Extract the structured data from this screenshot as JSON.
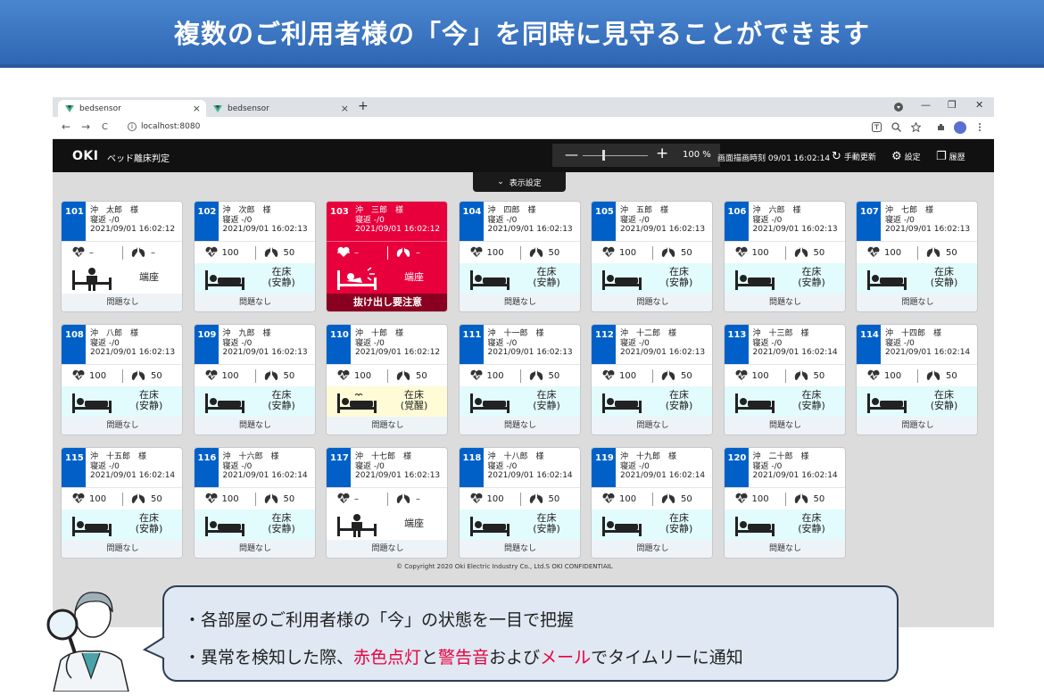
{
  "slide": {
    "title": "複数のご利用者様の「今」を同時に見守ることができます",
    "callout": {
      "line1": "・各部屋のご利用者様の「今」の状態を一目で把握",
      "line2_parts": [
        "・異常を検知した際、",
        "赤色点灯",
        "と",
        "警告音",
        "および",
        "メール",
        "でタイムリーに通知"
      ]
    }
  },
  "browser": {
    "tabs": [
      {
        "label": "bedsensor",
        "close": "×"
      },
      {
        "label": "bedsensor",
        "close": "×"
      }
    ],
    "new_tab": "+",
    "window_controls": {
      "minimize": "—",
      "restore": "❐",
      "close": "✕"
    },
    "nav": {
      "back": "←",
      "forward": "→",
      "reload": "C"
    },
    "url": "localhost:8080",
    "info_icon": "i"
  },
  "app": {
    "logo": "OKI",
    "title": "ベッド離床判定",
    "zoom": {
      "minus": "—",
      "plus": "+",
      "value": "100 %",
      "level": 0.3
    },
    "refresh_time": "画面描画時刻 09/01 16:02:14",
    "manual_refresh": "手動更新",
    "settings": "設定",
    "history": "履歴",
    "display_settings": "表示設定",
    "copyright": "© Copyright 2020 Oki Electric Industry Co., Ltd.S OKI CONFIDENTIAIL",
    "rooms": [
      {
        "room": "101",
        "name": "沖　太郎　様",
        "turn": "寝返 -/0",
        "time": "2021/09/01 16:02:12",
        "heart": "–",
        "breath": "–",
        "state": "sit",
        "status_text": "端座",
        "foot": "問題なし"
      },
      {
        "room": "102",
        "name": "沖　次郎　様",
        "turn": "寝返 -/0",
        "time": "2021/09/01 16:02:13",
        "heart": "100",
        "breath": "50",
        "state": "rest",
        "status_line1": "在床",
        "status_line2": "(安静)",
        "foot": "問題なし"
      },
      {
        "room": "103",
        "name": "沖　三郎　様",
        "turn": "寝返 -/0",
        "time": "2021/09/01 16:02:12",
        "heart": "–",
        "breath": "–",
        "state": "alert",
        "status_text": "端座",
        "foot": "抜け出し要注意"
      },
      {
        "room": "104",
        "name": "沖　四郎　様",
        "turn": "寝返 -/0",
        "time": "2021/09/01 16:02:13",
        "heart": "100",
        "breath": "50",
        "state": "rest",
        "status_line1": "在床",
        "status_line2": "(安静)",
        "foot": "問題なし"
      },
      {
        "room": "105",
        "name": "沖　五郎　様",
        "turn": "寝返 -/0",
        "time": "2021/09/01 16:02:13",
        "heart": "100",
        "breath": "50",
        "state": "rest",
        "status_line1": "在床",
        "status_line2": "(安静)",
        "foot": "問題なし"
      },
      {
        "room": "106",
        "name": "沖　六郎　様",
        "turn": "寝返 -/0",
        "time": "2021/09/01 16:02:13",
        "heart": "100",
        "breath": "50",
        "state": "rest",
        "status_line1": "在床",
        "status_line2": "(安静)",
        "foot": "問題なし"
      },
      {
        "room": "107",
        "name": "沖　七郎　様",
        "turn": "寝返 -/0",
        "time": "2021/09/01 16:02:13",
        "heart": "100",
        "breath": "50",
        "state": "rest",
        "status_line1": "在床",
        "status_line2": "(安静)",
        "foot": "問題なし"
      },
      {
        "room": "108",
        "name": "沖　八郎　様",
        "turn": "寝返 -/0",
        "time": "2021/09/01 16:02:13",
        "heart": "100",
        "breath": "50",
        "state": "rest",
        "status_line1": "在床",
        "status_line2": "(安静)",
        "foot": "問題なし"
      },
      {
        "room": "109",
        "name": "沖　九郎　様",
        "turn": "寝返 -/0",
        "time": "2021/09/01 16:02:13",
        "heart": "100",
        "breath": "50",
        "state": "rest",
        "status_line1": "在床",
        "status_line2": "(安静)",
        "foot": "問題なし"
      },
      {
        "room": "110",
        "name": "沖　十郎　様",
        "turn": "寝返 -/0",
        "time": "2021/09/01 16:02:12",
        "heart": "100",
        "breath": "50",
        "state": "awake",
        "status_line1": "在床",
        "status_line2": "(覚醒)",
        "foot": "問題なし"
      },
      {
        "room": "111",
        "name": "沖　十一郎　様",
        "turn": "寝返 -/0",
        "time": "2021/09/01 16:02:13",
        "heart": "100",
        "breath": "50",
        "state": "rest",
        "status_line1": "在床",
        "status_line2": "(安静)",
        "foot": "問題なし"
      },
      {
        "room": "112",
        "name": "沖　十二郎　様",
        "turn": "寝返 -/0",
        "time": "2021/09/01 16:02:13",
        "heart": "100",
        "breath": "50",
        "state": "rest",
        "status_line1": "在床",
        "status_line2": "(安静)",
        "foot": "問題なし"
      },
      {
        "room": "113",
        "name": "沖　十三郎　様",
        "turn": "寝返 -/0",
        "time": "2021/09/01 16:02:14",
        "heart": "100",
        "breath": "50",
        "state": "rest",
        "status_line1": "在床",
        "status_line2": "(安静)",
        "foot": "問題なし"
      },
      {
        "room": "114",
        "name": "沖　十四郎　様",
        "turn": "寝返 -/0",
        "time": "2021/09/01 16:02:14",
        "heart": "100",
        "breath": "50",
        "state": "rest",
        "status_line1": "在床",
        "status_line2": "(安静)",
        "foot": "問題なし"
      },
      {
        "room": "115",
        "name": "沖　十五郎　様",
        "turn": "寝返 -/0",
        "time": "2021/09/01 16:02:14",
        "heart": "100",
        "breath": "50",
        "state": "rest",
        "status_line1": "在床",
        "status_line2": "(安静)",
        "foot": "問題なし"
      },
      {
        "room": "116",
        "name": "沖　十六郎　様",
        "turn": "寝返 -/0",
        "time": "2021/09/01 16:02:14",
        "heart": "100",
        "breath": "50",
        "state": "rest",
        "status_line1": "在床",
        "status_line2": "(安静)",
        "foot": "問題なし"
      },
      {
        "room": "117",
        "name": "沖　十七郎　様",
        "turn": "寝返 -/0",
        "time": "2021/09/01 16:02:13",
        "heart": "–",
        "breath": "–",
        "state": "sit",
        "status_text": "端座",
        "foot": "問題なし"
      },
      {
        "room": "118",
        "name": "沖　十八郎　様",
        "turn": "寝返 -/0",
        "time": "2021/09/01 16:02:14",
        "heart": "100",
        "breath": "50",
        "state": "rest",
        "status_line1": "在床",
        "status_line2": "(安静)",
        "foot": "問題なし"
      },
      {
        "room": "119",
        "name": "沖　十九郎　様",
        "turn": "寝返 -/0",
        "time": "2021/09/01 16:02:14",
        "heart": "100",
        "breath": "50",
        "state": "rest",
        "status_line1": "在床",
        "status_line2": "(安静)",
        "foot": "問題なし"
      },
      {
        "room": "120",
        "name": "沖　二十郎　様",
        "turn": "寝返 -/0",
        "time": "2021/09/01 16:02:14",
        "heart": "100",
        "breath": "50",
        "state": "rest",
        "status_line1": "在床",
        "status_line2": "(安静)",
        "foot": "問題なし"
      }
    ]
  },
  "icons": {
    "heart": "heart-pulse-icon",
    "breath": "lungs-icon",
    "in_bed": "person-in-bed-icon",
    "sitting": "person-sitting-icon",
    "alert": "alarm-bed-icon"
  },
  "colors": {
    "room_blue": "#0060c8",
    "alert_red": "#e8003c",
    "rest_bg": "#e2fbfc",
    "awake_bg": "#fffbd6",
    "banner_blue": "#2f66b3"
  }
}
